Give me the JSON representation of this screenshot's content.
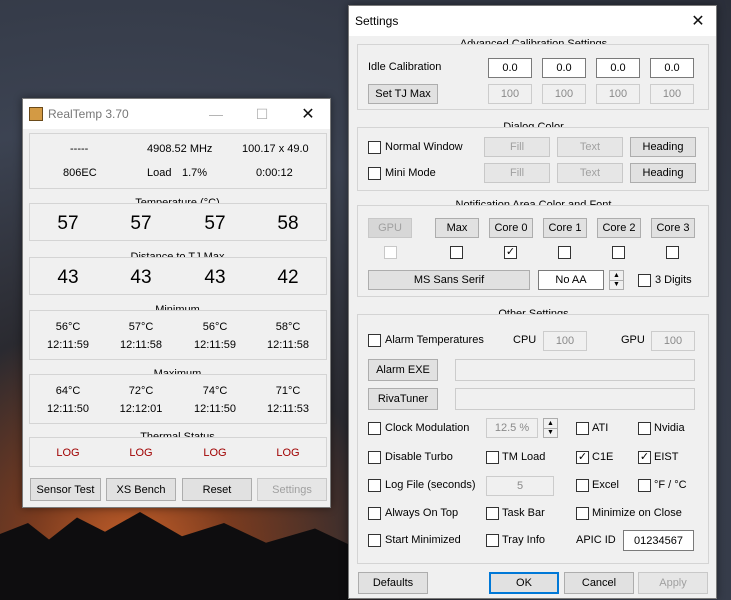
{
  "realtemp": {
    "title": "RealTemp 3.70",
    "info": {
      "cpu_id": "-----",
      "mhz": "4908.52 MHz",
      "multiplier": "100.17 x 49.0",
      "code": "806EC",
      "load_label": "Load",
      "load_value": "1.7%",
      "time": "0:00:12"
    },
    "temperature": {
      "header": "Temperature (°C)",
      "values": [
        "57",
        "57",
        "57",
        "58"
      ]
    },
    "distance": {
      "header": "Distance to TJ Max",
      "values": [
        "43",
        "43",
        "43",
        "42"
      ]
    },
    "minimum": {
      "header": "Minimum",
      "temps": [
        "56°C",
        "57°C",
        "56°C",
        "58°C"
      ],
      "times": [
        "12:11:59",
        "12:11:58",
        "12:11:59",
        "12:11:58"
      ]
    },
    "maximum": {
      "header": "Maximum",
      "temps": [
        "64°C",
        "72°C",
        "74°C",
        "71°C"
      ],
      "times": [
        "12:11:50",
        "12:12:01",
        "12:11:50",
        "12:11:53"
      ]
    },
    "thermal": {
      "header": "Thermal Status",
      "values": [
        "LOG",
        "LOG",
        "LOG",
        "LOG"
      ]
    },
    "buttons": {
      "sensor_test": "Sensor Test",
      "xs_bench": "XS Bench",
      "reset": "Reset",
      "settings": "Settings"
    }
  },
  "settings": {
    "title": "Settings",
    "advanced": {
      "header": "Advanced Calibration Settings",
      "idle_label": "Idle Calibration",
      "idle_values": [
        "0.0",
        "0.0",
        "0.0",
        "0.0"
      ],
      "set_tj_label": "Set TJ Max",
      "tj_values": [
        "100",
        "100",
        "100",
        "100"
      ]
    },
    "dialog_color": {
      "header": "Dialog Color",
      "normal_window": "Normal Window",
      "mini_mode": "Mini Mode",
      "fill": "Fill",
      "text": "Text",
      "heading": "Heading"
    },
    "notification": {
      "header": "Notification Area Color and Font",
      "buttons": [
        "GPU",
        "Max",
        "Core 0",
        "Core 1",
        "Core 2",
        "Core 3"
      ],
      "checks": [
        false,
        false,
        true,
        false,
        false,
        false
      ],
      "font": "MS Sans Serif",
      "aa": "No AA",
      "three_digits": "3 Digits"
    },
    "other": {
      "header": "Other Settings",
      "alarm_temps": "Alarm Temperatures",
      "cpu_label": "CPU",
      "cpu_value": "100",
      "gpu_label": "GPU",
      "gpu_value": "100",
      "alarm_exe": "Alarm EXE",
      "rivatuner": "RivaTuner",
      "clock_modulation": "Clock Modulation",
      "clock_value": "12.5 %",
      "ati": "ATI",
      "nvidia": "Nvidia",
      "disable_turbo": "Disable Turbo",
      "tm_load": "TM Load",
      "c1e": "C1E",
      "eist": "EIST",
      "log_file": "Log File (seconds)",
      "log_value": "5",
      "excel": "Excel",
      "f_c": "°F / °C",
      "always_on_top": "Always On Top",
      "task_bar": "Task Bar",
      "minimize_on_close": "Minimize on Close",
      "start_minimized": "Start Minimized",
      "tray_info": "Tray Info",
      "apic_label": "APIC ID",
      "apic_value": "01234567"
    },
    "buttons": {
      "defaults": "Defaults",
      "ok": "OK",
      "cancel": "Cancel",
      "apply": "Apply"
    }
  },
  "icons": {
    "minimize": "minimize-icon",
    "maximize": "maximize-icon",
    "close": "close-icon",
    "app": "realtemp-app-icon"
  }
}
